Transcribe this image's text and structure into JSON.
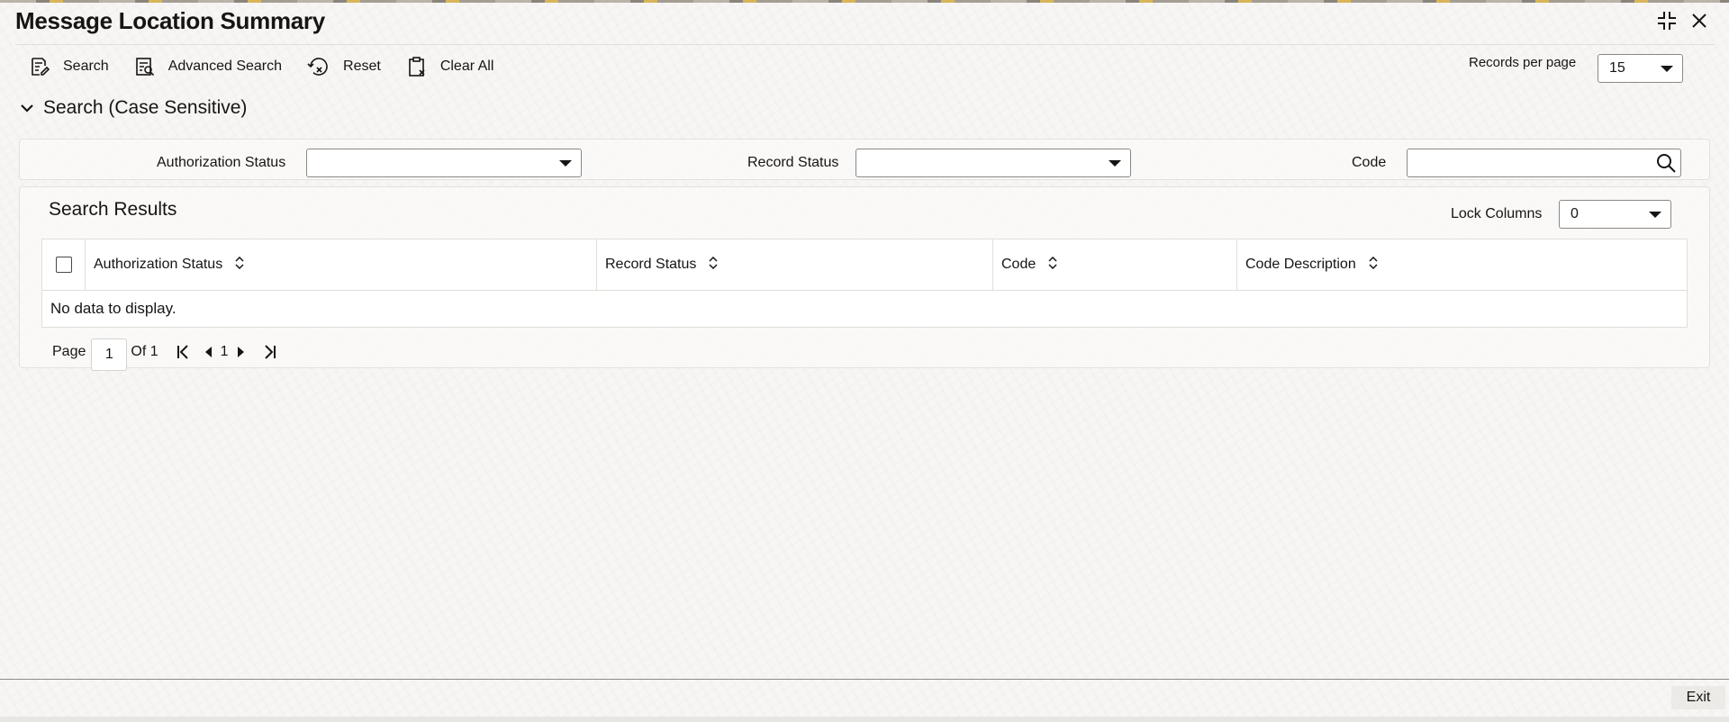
{
  "window": {
    "title": "Message Location Summary",
    "icons": [
      "collapse-icon",
      "close-icon"
    ]
  },
  "toolbar": {
    "search_label": "Search",
    "advanced_search_label": "Advanced Search",
    "reset_label": "Reset",
    "clear_all_label": "Clear All",
    "records_per_page_label": "Records per page",
    "records_per_page_value": "15"
  },
  "search_section": {
    "title": "Search (Case Sensitive)",
    "authorization_status_label": "Authorization Status",
    "authorization_status_value": "",
    "record_status_label": "Record Status",
    "record_status_value": "",
    "code_label": "Code",
    "code_value": ""
  },
  "results": {
    "title": "Search Results",
    "lock_columns_label": "Lock Columns",
    "lock_columns_value": "0",
    "columns": [
      "Authorization Status",
      "Record Status",
      "Code",
      "Code Description"
    ],
    "empty_message": "No data to display."
  },
  "pagination": {
    "page_label": "Page",
    "current_page": "1",
    "of_label": "Of 1",
    "page_number": "1"
  },
  "footer": {
    "exit_label": "Exit"
  },
  "colors": {
    "text": "#161513",
    "border": "#8b8883",
    "background": "#f7f6f4"
  }
}
